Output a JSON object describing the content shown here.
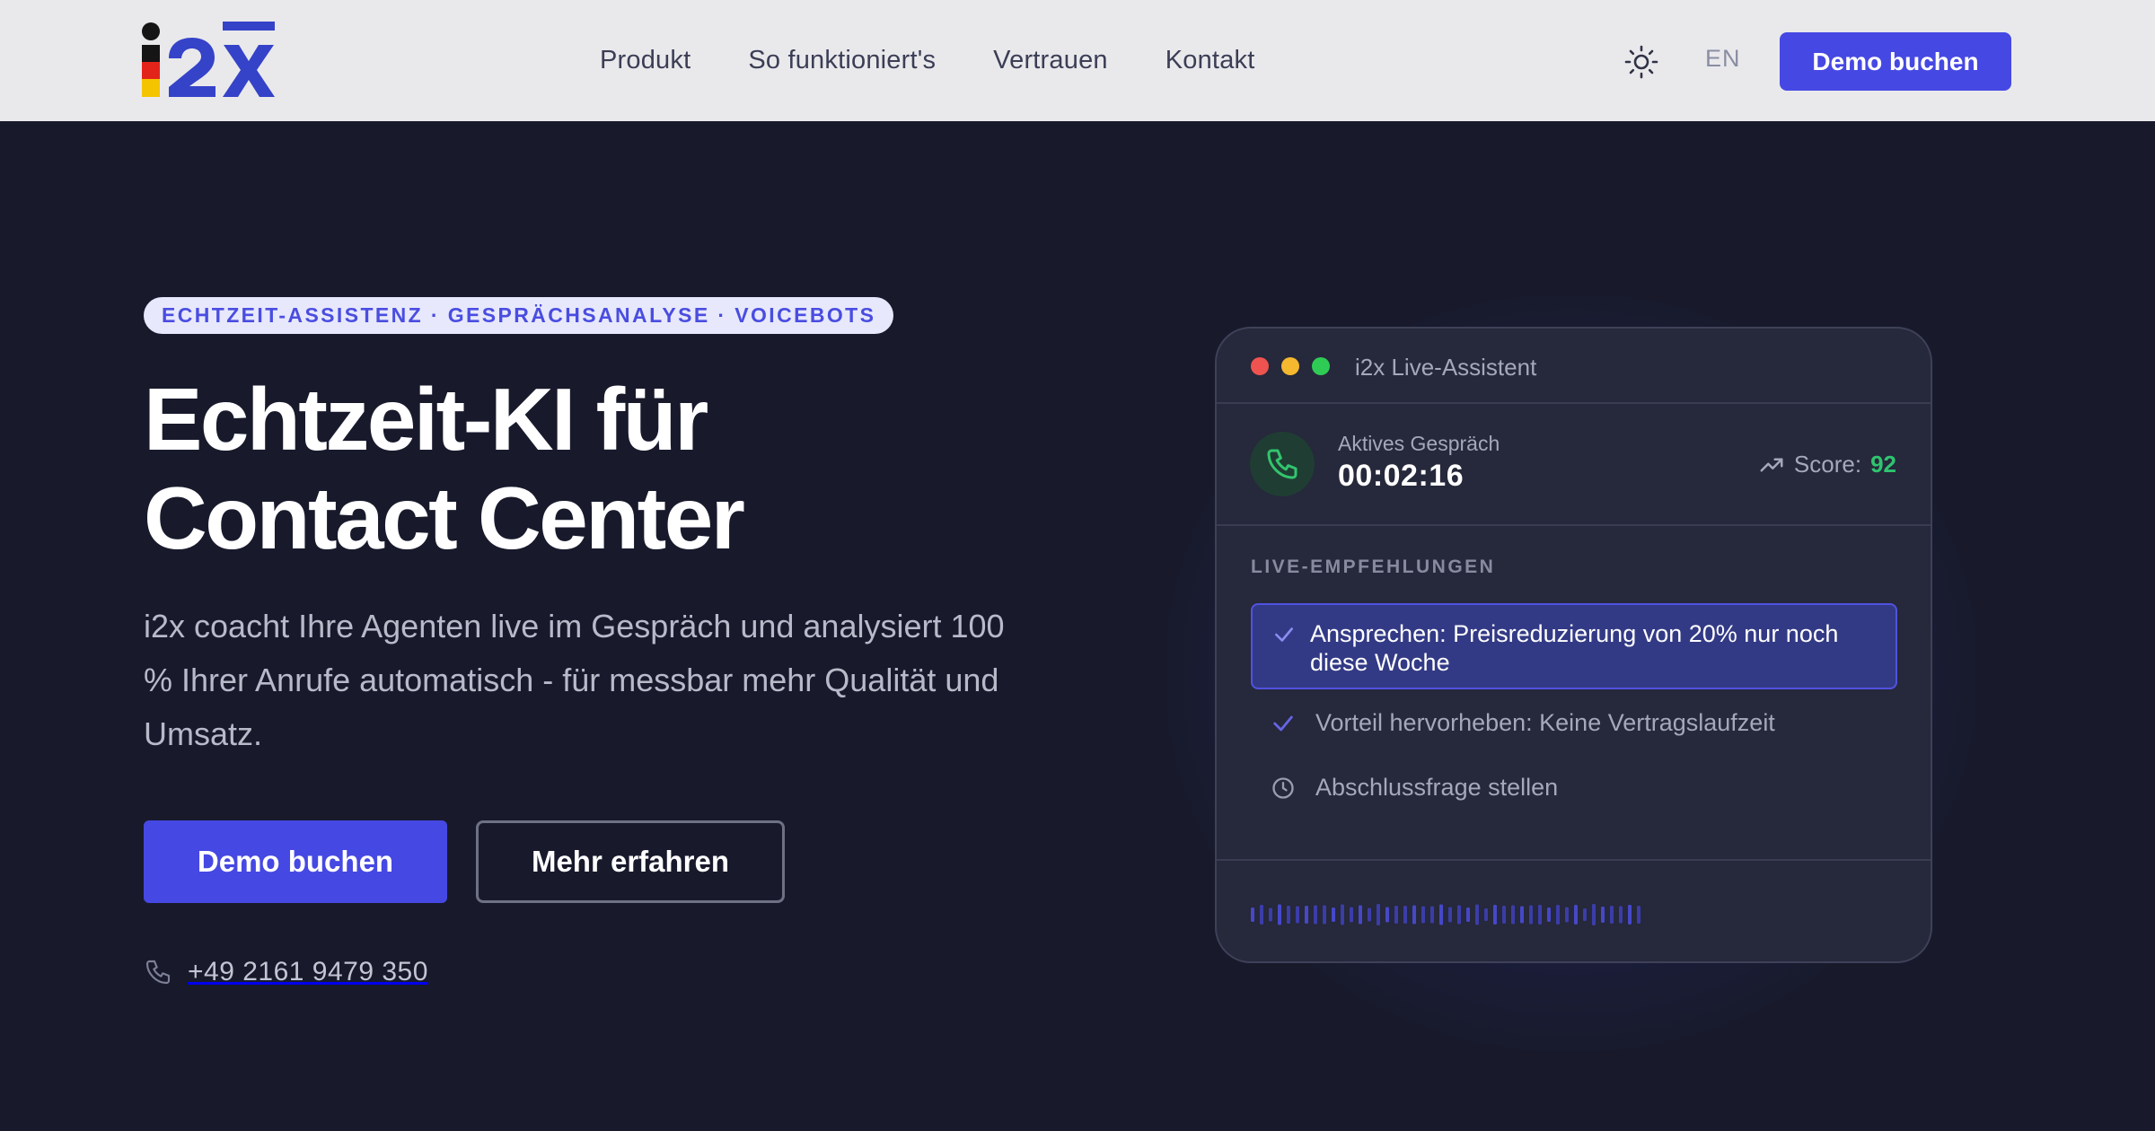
{
  "header": {
    "logo_text": "i2x",
    "nav": [
      "Produkt",
      "So funktioniert's",
      "Vertrauen",
      "Kontakt"
    ],
    "theme_icon": "sun-icon",
    "language": "EN",
    "cta_label": "Demo buchen"
  },
  "hero": {
    "badge": "ECHTZEIT-ASSISTENZ · GESPRÄCHSANALYSE · VOICEBOTS",
    "title_line1": "Echtzeit-KI für",
    "title_line2": "Contact Center",
    "lead": "i2x coacht Ihre Agenten live im Gespräch und analysiert 100 % Ihrer Anrufe automatisch - für messbar mehr Qualität und Umsatz.",
    "primary_cta": "Demo buchen",
    "secondary_cta": "Mehr erfahren",
    "phone": "+49 2161 9479 350"
  },
  "assistant": {
    "title": "i2x Live-Assistent",
    "call_label": "Aktives Gespräch",
    "call_timer": "00:02:16",
    "score_label": "Score:",
    "score_value": "92",
    "recommendations_heading": "LIVE-EMPFEHLUNGEN",
    "recommendations": [
      {
        "text": "Ansprechen: Preisreduzierung von 20% nur noch diese Woche",
        "icon": "check-icon",
        "state": "active"
      },
      {
        "text": "Vorteil hervorheben: Keine Vertragslaufzeit",
        "icon": "check-icon",
        "state": "done"
      },
      {
        "text": "Abschlussfrage stellen",
        "icon": "clock-icon",
        "state": "pending"
      }
    ]
  },
  "colors": {
    "page_bg": "#181a2c",
    "header_bg": "#e9e9ec",
    "accent": "#4648e3",
    "score_green": "#2fc46f",
    "dot_red": "#ef5350",
    "dot_yellow": "#f5b82e",
    "dot_green": "#2ecc55"
  }
}
